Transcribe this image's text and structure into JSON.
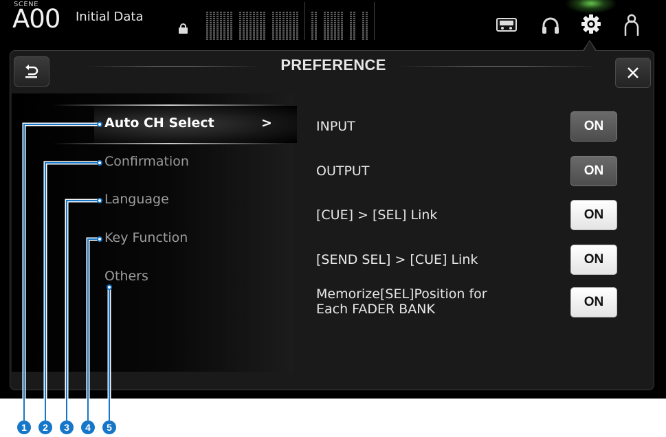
{
  "header": {
    "scene_caption": "SCENE",
    "scene_number": "A00",
    "scene_title": "Initial Data",
    "icons": [
      "lock-icon",
      "recorder-icon",
      "headphones-icon",
      "gear-icon",
      "user-icon"
    ],
    "accent_glow": "#66dd44"
  },
  "panel": {
    "title": "PREFERENCE",
    "back_button": "back-arrow-icon",
    "close_button": "close-icon"
  },
  "menu": {
    "items": [
      {
        "label": "Auto CH Select",
        "active": true,
        "arrow": ">"
      },
      {
        "label": "Confirmation",
        "active": false
      },
      {
        "label": "Language",
        "active": false
      },
      {
        "label": "Key Function",
        "active": false
      },
      {
        "label": "Others",
        "active": false
      }
    ]
  },
  "settings": [
    {
      "label": "INPUT",
      "value": "ON",
      "style": "dark"
    },
    {
      "label": "OUTPUT",
      "value": "ON",
      "style": "dark"
    },
    {
      "label": "[CUE] > [SEL] Link",
      "value": "ON",
      "style": "light"
    },
    {
      "label": "[SEND SEL] > [CUE] Link",
      "value": "ON",
      "style": "light"
    },
    {
      "label_line1": "Memorize[SEL]Position for",
      "label_line2": "Each FADER BANK",
      "value": "ON",
      "style": "light"
    }
  ],
  "callouts": {
    "numbers": [
      "1",
      "2",
      "3",
      "4",
      "5"
    ],
    "color": "#1676c7"
  }
}
